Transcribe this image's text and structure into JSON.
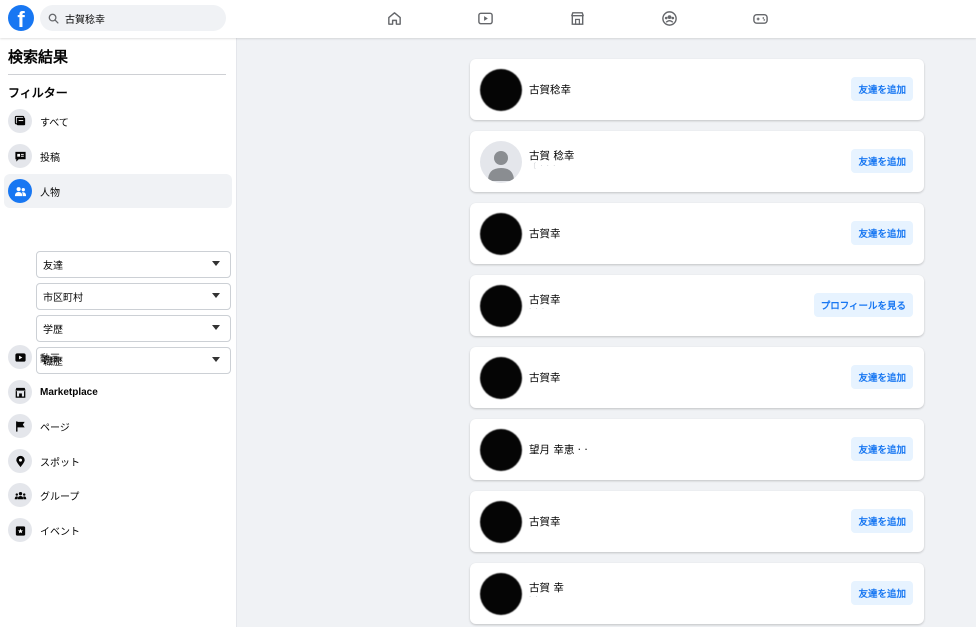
{
  "header": {
    "logo": "f",
    "search_value": "古賀稔幸",
    "nav_icons": [
      "home-icon",
      "video-icon",
      "marketplace-icon",
      "groups-icon",
      "gaming-icon"
    ]
  },
  "sidebar": {
    "title": "検索結果",
    "filter_heading": "フィルター",
    "items": [
      {
        "label": "すべて",
        "icon": "feed-icon"
      },
      {
        "label": "投稿",
        "icon": "post-icon"
      },
      {
        "label": "人物",
        "icon": "people-icon"
      },
      {
        "label": "動画",
        "icon": "video-icon"
      },
      {
        "label": "Marketplace",
        "icon": "marketplace-icon"
      },
      {
        "label": "ページ",
        "icon": "flag-icon"
      },
      {
        "label": "スポット",
        "icon": "pin-icon"
      },
      {
        "label": "グループ",
        "icon": "groups-icon"
      },
      {
        "label": "イベント",
        "icon": "event-icon"
      }
    ],
    "dropdowns": [
      "友達",
      "市区町村",
      "学歴",
      "職歴"
    ]
  },
  "results": [
    {
      "name": "古賀稔幸",
      "subtitle": "",
      "button": "友達を追加"
    },
    {
      "name": "古賀 稔幸",
      "subtitle": "〔  ·   ·      ·",
      "button": "友達を追加"
    },
    {
      "name": "古賀幸",
      "subtitle": "",
      "button": "友達を追加"
    },
    {
      "name": "古賀幸",
      "subtitle": "     ·         ·            ·",
      "button": "プロフィールを見る"
    },
    {
      "name": "古賀幸",
      "subtitle": "",
      "button": "友達を追加"
    },
    {
      "name": "望月 幸恵 ·  ·",
      "subtitle": "",
      "button": "友達を追加"
    },
    {
      "name": "古賀幸",
      "subtitle": "",
      "button": "友達を追加"
    },
    {
      "name": "古賀 幸",
      "subtitle": "    ·  ·",
      "button": "友達を追加"
    }
  ],
  "colors": {
    "accent": "#1877f2",
    "button_bg": "#e7f3ff",
    "page_bg": "#f0f2f5"
  }
}
